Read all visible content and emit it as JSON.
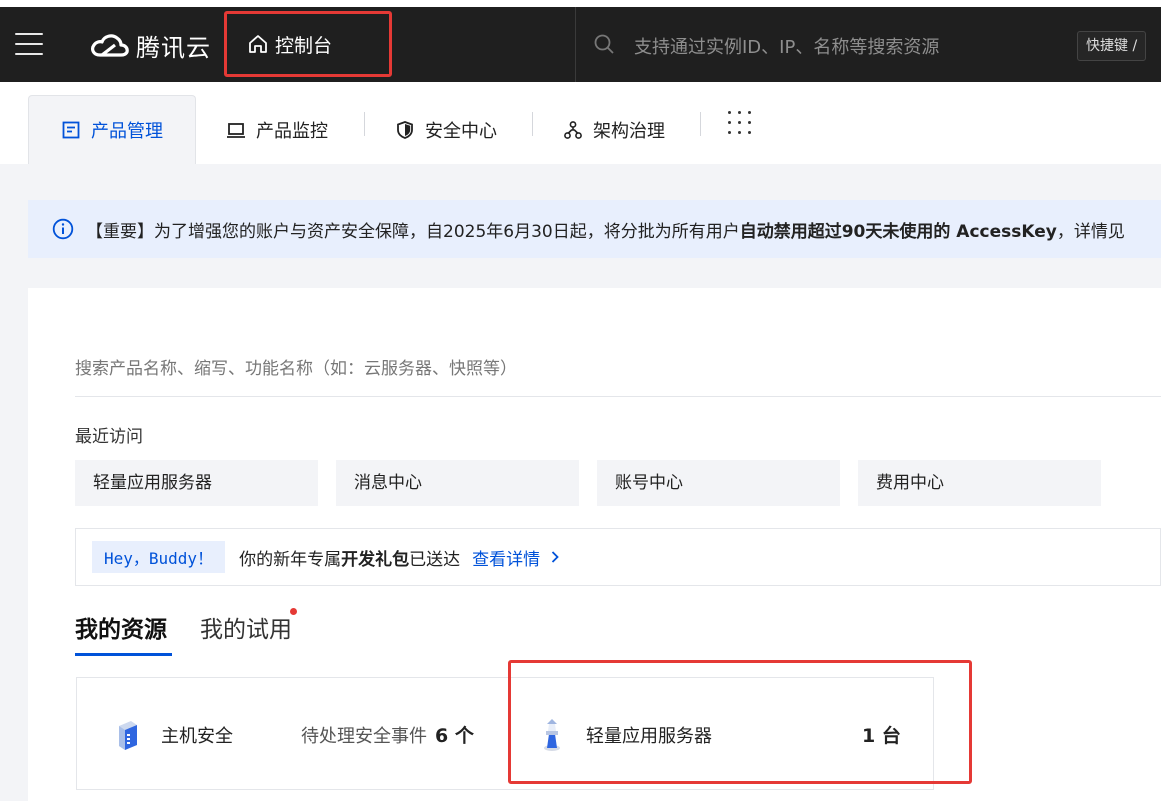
{
  "topbar": {
    "brand": "腾讯云",
    "console_label": "控制台",
    "search_placeholder": "支持通过实例ID、IP、名称等搜索资源",
    "shortcut_label": "快捷键 /"
  },
  "tabs": [
    {
      "label": "产品管理",
      "icon": "document-icon",
      "active": true
    },
    {
      "label": "产品监控",
      "icon": "monitor-icon",
      "active": false
    },
    {
      "label": "安全中心",
      "icon": "shield-icon",
      "active": false
    },
    {
      "label": "架构治理",
      "icon": "architecture-icon",
      "active": false
    }
  ],
  "notice": {
    "prefix": "【重要】为了增强您的账户与资产安全保障，自2025年6月30日起，将分批为所有用户",
    "bold": "自动禁用超过90天未使用的 AccessKey",
    "suffix": "，详情见"
  },
  "product_search": {
    "placeholder": "搜索产品名称、缩写、功能名称（如：云服务器、快照等）"
  },
  "recent": {
    "title": "最近访问",
    "items": [
      "轻量应用服务器",
      "消息中心",
      "账号中心",
      "费用中心"
    ]
  },
  "promo": {
    "badge": "Hey，Buddy！",
    "text_before": "你的新年专属",
    "text_bold": "开发礼包",
    "text_after": "已送达",
    "link": "查看详情"
  },
  "resources": {
    "tab_active": "我的资源",
    "tab_inactive": "我的试用",
    "cards": [
      {
        "name": "主机安全",
        "detail": "待处理安全事件",
        "count": "6 个",
        "icon": "host-security-icon"
      },
      {
        "name": "轻量应用服务器",
        "count": "1 台",
        "icon": "lighthouse-icon"
      }
    ]
  },
  "colors": {
    "accent": "#0052d9",
    "topbar": "#1f1f1f",
    "highlight": "#e53935"
  }
}
